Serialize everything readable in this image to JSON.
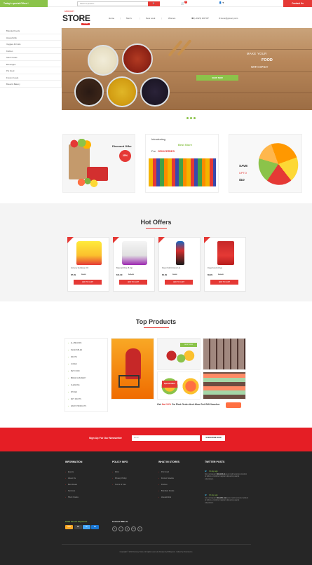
{
  "topbar": {
    "special_offers": "Today's special Offers !",
    "search_placeholder": "Search a product...",
    "search_button": "🔍",
    "cart_count": "0",
    "user_label": "👤 ▾",
    "contact": "Contact Us"
  },
  "header": {
    "logo_small": "GROCERY",
    "logo": "STORE",
    "logo_tag": "ONLINE",
    "nav": [
      "Home",
      "Men's",
      "New Look",
      "Women"
    ],
    "phone": "☎ (+0123) 234 567",
    "email": "✉ store@grocery.com"
  },
  "sidebar": {
    "items": [
      "Branded Foods",
      "Households",
      "Veggies & Fruits",
      "Kitchen",
      "Short Codes",
      "Beverages",
      "Pet Food",
      "Frozen Foods",
      "Bread & Bakery"
    ]
  },
  "banner": {
    "line1": "MAKE YOUR",
    "line2": "FOOD",
    "line3": "WITH SPICY",
    "button": "SHOP NOW"
  },
  "promos": {
    "discount_title": "Discount Offer",
    "discount_badge": "25%",
    "intro_line1": "Introducing",
    "intro_best": "Best Store",
    "intro_line2": "For",
    "intro_groceries": "GROCERIES",
    "save": "SAVE",
    "upto": "UPTO",
    "amount": "$10"
  },
  "hot_offers": {
    "title": "Hot Offers",
    "products": [
      {
        "name": "Fortune Sunflower Oil",
        "price": "$7.99",
        "old": "$9.00",
        "button": "ADD TO CART"
      },
      {
        "name": "Basmati Rice (5 Kg)",
        "price": "$11.99",
        "old": "$15.00",
        "button": "ADD TO CART"
      },
      {
        "name": "Pepsi Soft Drink (2 Ltr)",
        "price": "$4.99",
        "old": "$6.00",
        "button": "ADD TO CART"
      },
      {
        "name": "Dogs Food (4 Kg)",
        "price": "$9.99",
        "old": "$11.00",
        "button": "ADD TO CART"
      }
    ]
  },
  "top_products": {
    "title": "Top Products",
    "categories": [
      "ALL BRANDS",
      "VEGETABLES",
      "FRUITS",
      "JUICES",
      "PET FOOD",
      "BREAD & BAKERY",
      "CLEANING",
      "SPICES",
      "DRY FRUITS",
      "DAIRY PRODUCTS"
    ],
    "shop_now": "SHOP NOW",
    "special_offers": "Special Offers",
    "gift_prefix": "Get",
    "gift_highlight": "flat 10%",
    "gift_suffix": "On First Order And Also Get Gift Voucher"
  },
  "newsletter": {
    "label": "Sign Up For Our Newsletter",
    "placeholder": "Email",
    "button": "SUBSCRIBE NOW"
  },
  "footer": {
    "information_title": "INFORMATION",
    "information_links": [
      "Events",
      "About Us",
      "Best Deals",
      "Services",
      "Short Codes"
    ],
    "policy_title": "POLICY INFO",
    "policy_links": [
      "FAQ",
      "Privacy Policy",
      "Terms of Use"
    ],
    "stores_title": "WHAT IN STORES",
    "stores_links": [
      "Pet Food",
      "Frozen Snacks",
      "Kitchen",
      "Branded Foods",
      "Households"
    ],
    "twitter_title": "TWITTER POSTS",
    "tweets": [
      {
        "time": "01 day ago",
        "text": "Non numquam",
        "link": "http://sd.ds",
        "rest": "eius modi tempora incidunt ut labore et dolore magnam aliquam quaerat voluptatem."
      },
      {
        "time": "02 day ago",
        "text": "Con numquam",
        "link": "http://fel.com",
        "rest": "eius modi tempora incidunt ut labore et dolore magnam aliquam quaerat voluptatem."
      }
    ],
    "payments_title": "100% Secure Payments",
    "payments": [
      "VISA",
      "MC",
      "PP",
      "AE"
    ],
    "connect_title": "Connect With Us",
    "social": [
      "f",
      "t",
      "g",
      "in",
      "p"
    ],
    "copyright": "Copyright © 2016 Grocery Store. All rights reserved | Design by W3layouts . Edited by Downdemo"
  },
  "colors": {
    "accent_red": "#e53935",
    "accent_green": "#8bc34a",
    "footer_bg": "#262626",
    "newsletter_bg": "#e51e25"
  }
}
